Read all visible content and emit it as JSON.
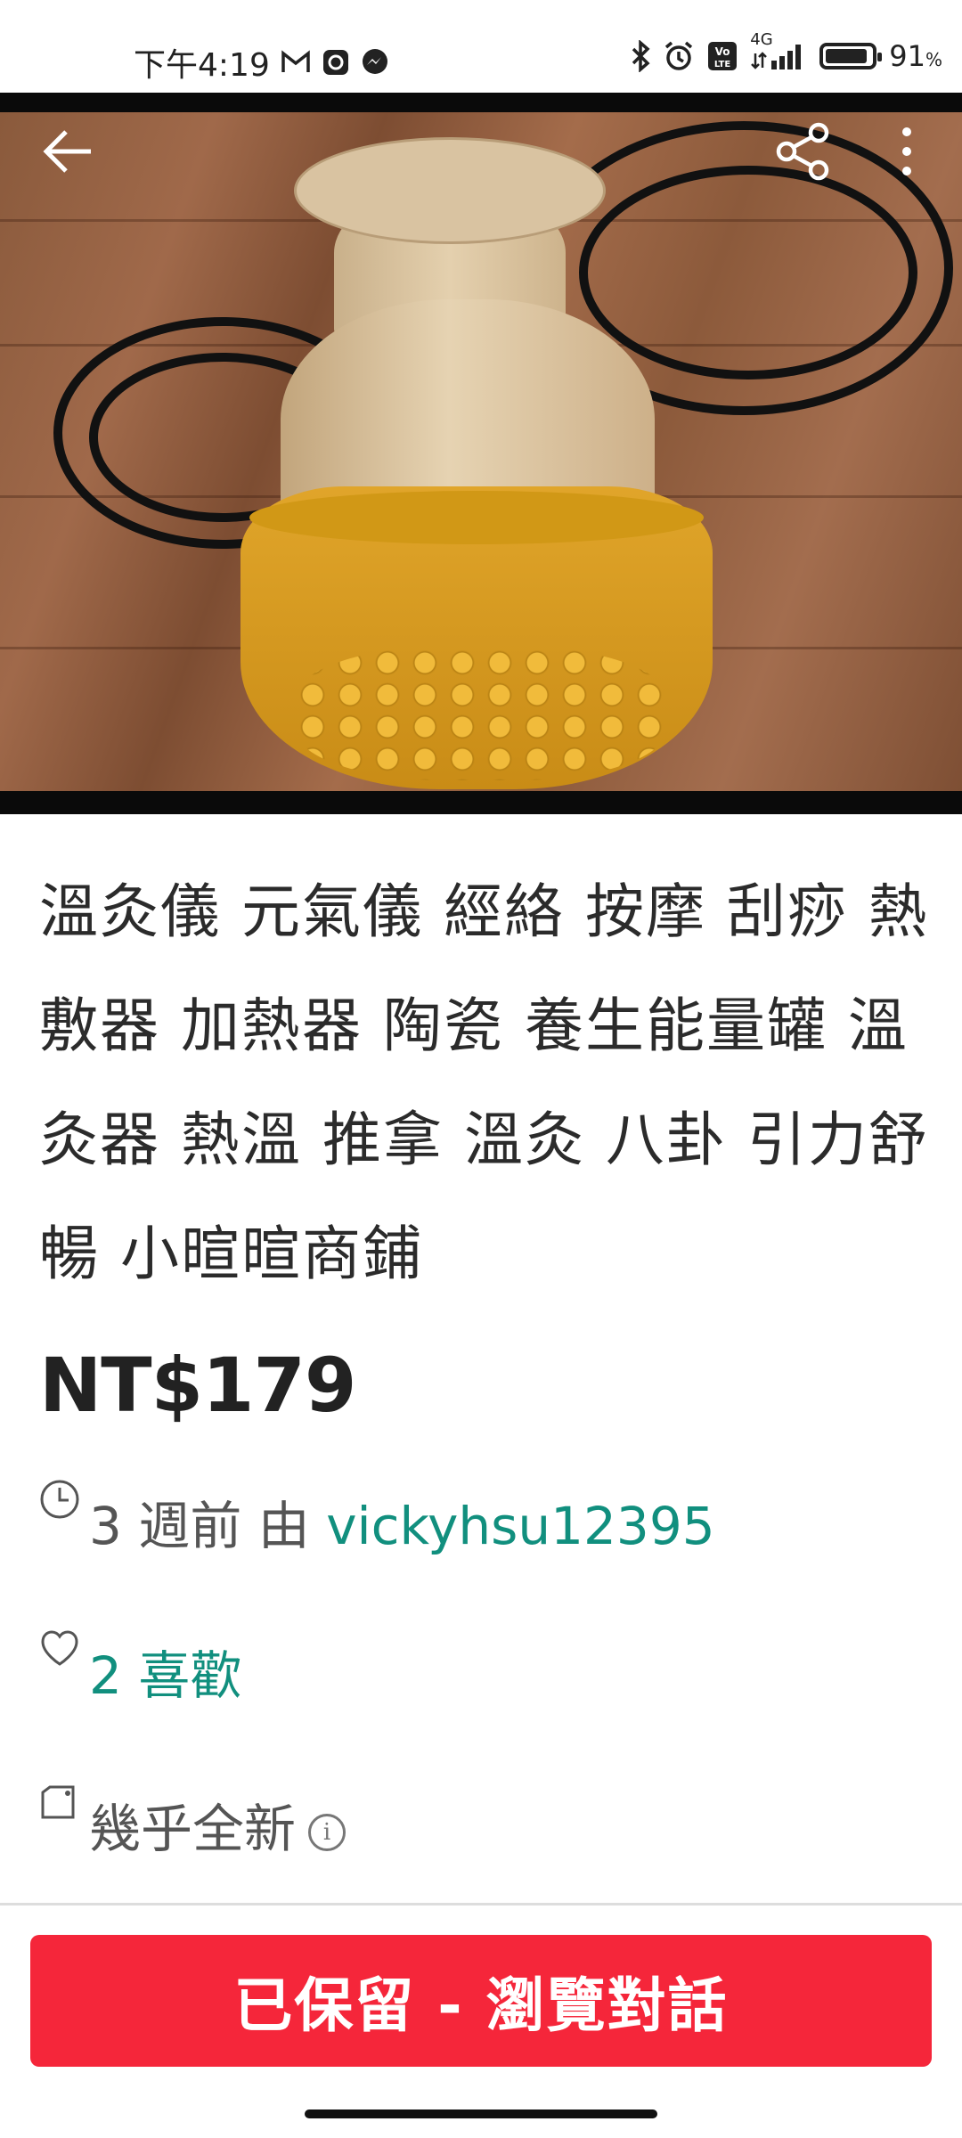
{
  "status_bar": {
    "time": "下午4:19",
    "network": "4G",
    "battery_percent": "91",
    "battery_level": 0.91,
    "percent_sign": "%",
    "icons": [
      "gmail-icon",
      "app-icon",
      "messenger-icon",
      "bluetooth-icon",
      "alarm-icon",
      "volte-icon",
      "signal-icon",
      "battery-icon"
    ]
  },
  "photo": {
    "image_count": 4,
    "active_index": 0,
    "accent_color": "#118f7e"
  },
  "listing": {
    "title": "溫灸儀 元氣儀 經絡 按摩 刮痧 熱敷器 加熱器 陶瓷 養生能量罐 溫灸器 熱溫 推拿 溫灸 八卦 引力舒暢 小暄暄商鋪",
    "price": "NT$179",
    "posted_prefix": "3 週前 由 ",
    "seller": "vickyhsu12395",
    "likes": "2 喜歡",
    "condition": "幾乎全新",
    "info_glyph": "i"
  },
  "cta": {
    "label": "已保留 - 瀏覽對話",
    "color": "#f5263a"
  }
}
